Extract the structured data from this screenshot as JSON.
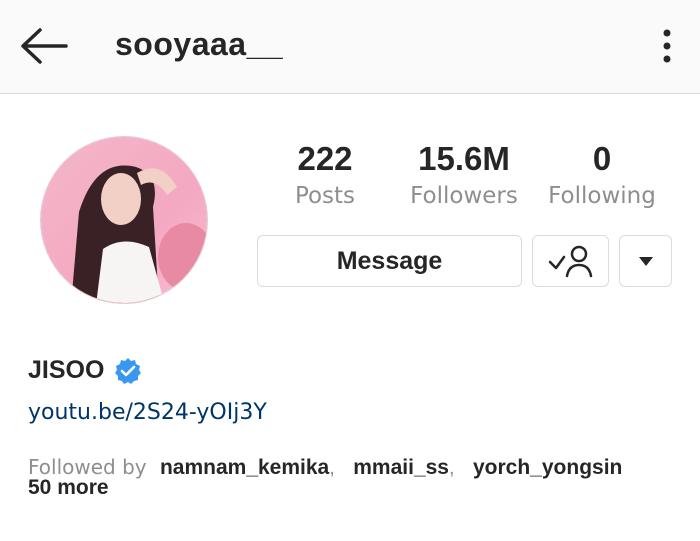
{
  "header": {
    "back_icon": "arrow-left-icon",
    "username": "sooyaaa__",
    "more_icon": "kebab-vertical-icon"
  },
  "profile": {
    "avatar_icon": "profile-photo",
    "stats": [
      {
        "value": "222",
        "label": "Posts"
      },
      {
        "value": "15.6M",
        "label": "Followers"
      },
      {
        "value": "0",
        "label": "Following"
      }
    ],
    "message_label": "Message",
    "following_icon": "person-check-icon",
    "dropdown_icon": "caret-down-icon",
    "name": "JISOO",
    "verified_icon": "verified-badge-icon",
    "link": "youtu.be/2S24-yOIj3Y",
    "followed_by_prefix": "Followed by",
    "followed_by": [
      "namnam_kemika",
      "mmaii_ss",
      "yorch_yongsin"
    ],
    "followed_by_more": "50 more"
  },
  "colors": {
    "text": "#262626",
    "secondary": "#8e8e8e",
    "link": "#003569",
    "verified": "#3897f0",
    "border": "#dbdbdb"
  }
}
